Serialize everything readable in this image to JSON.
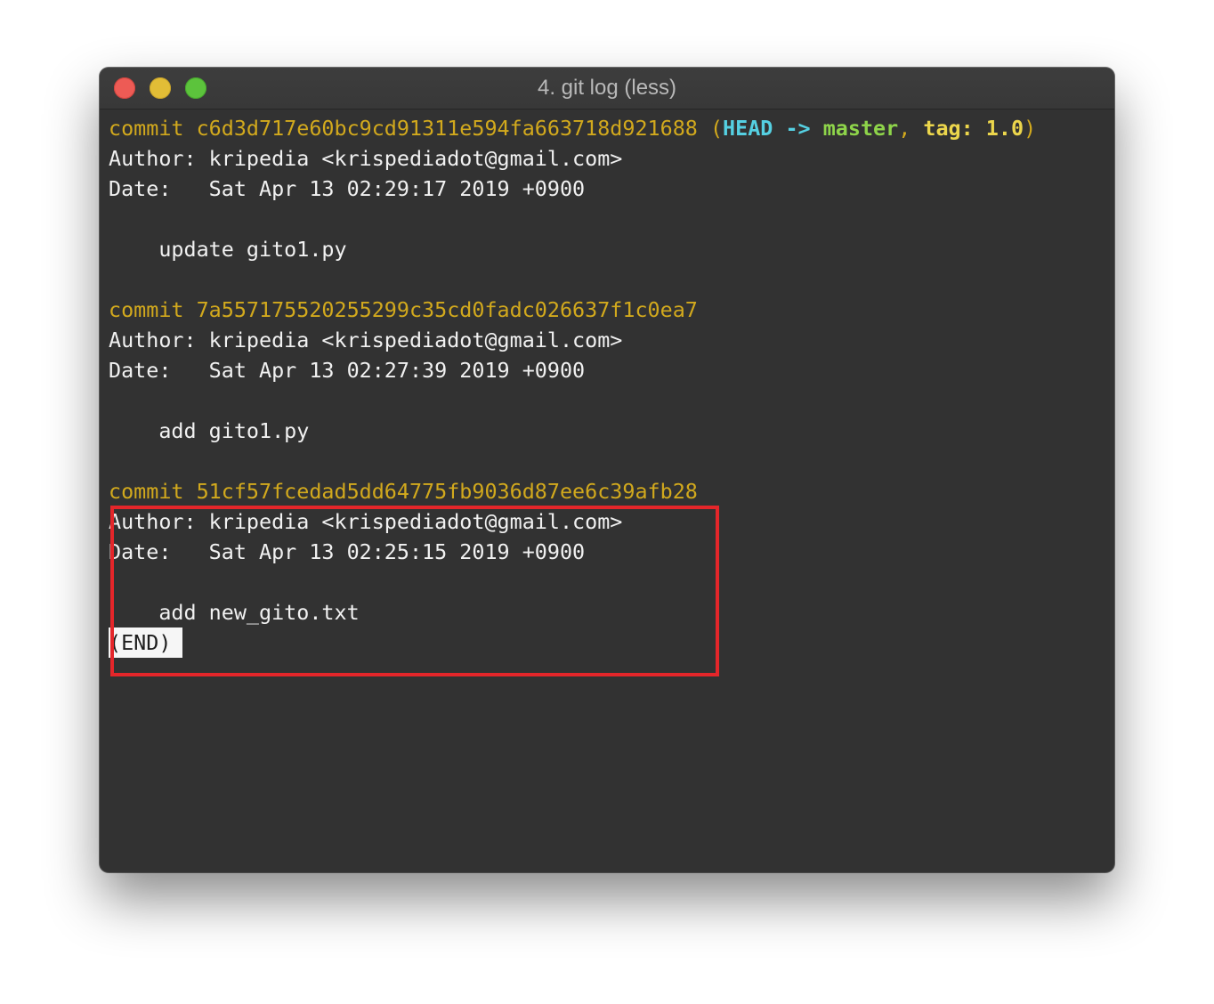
{
  "window": {
    "title": "4. git log (less)",
    "traffic_lights": {
      "close_color": "#ed5b55",
      "minimize_color": "#e2bd36",
      "zoom_color": "#5cc33c"
    }
  },
  "colors": {
    "background": "#323232",
    "commit_hash": "#d2a91d",
    "head_ref": "#55d0e2",
    "branch_ref": "#8ed44a",
    "tag_ref": "#ecd64c",
    "text": "#f1f1f1",
    "highlight_box": "#e4262a"
  },
  "commits": [
    {
      "commit_line": "commit c6d3d717e60bc9cd91311e594fa663718d921688",
      "refs": {
        "open": " (",
        "head": "HEAD -> ",
        "branch": "master",
        "sep": ", ",
        "tag": "tag: 1.0",
        "close": ")"
      },
      "author_line": "Author: kripedia <krispediadot@gmail.com>",
      "date_line": "Date:   Sat Apr 13 02:29:17 2019 +0900",
      "message_line": "    update gito1.py"
    },
    {
      "commit_line": "commit 7a557175520255299c35cd0fadc026637f1c0ea7",
      "author_line": "Author: kripedia <krispediadot@gmail.com>",
      "date_line": "Date:   Sat Apr 13 02:27:39 2019 +0900",
      "message_line": "    add gito1.py"
    },
    {
      "commit_line": "commit 51cf57fcedad5dd64775fb9036d87ee6c39afb28",
      "author_line": "Author: kripedia <krispediadot@gmail.com>",
      "date_line": "Date:   Sat Apr 13 02:25:15 2019 +0900",
      "message_line": "    add new_gito.txt"
    }
  ],
  "pager": {
    "end_marker": "(END)"
  }
}
